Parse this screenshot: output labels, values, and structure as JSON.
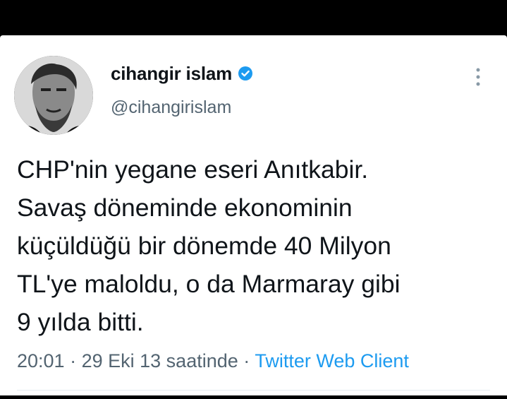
{
  "author": {
    "display_name": "cihangir islam",
    "handle": "@cihangirislam",
    "verified": true
  },
  "tweet": {
    "lines": [
      "CHP'nin yegane eseri Anıtkabir.",
      "Savaş döneminde ekonominin",
      "küçüldüğü bir dönemde 40 Milyon",
      "TL'ye maloldu, o da Marmaray gibi",
      "9 yılda bitti."
    ],
    "time": "20:01",
    "separator": "·",
    "date": "29 Eki 13 saatinde",
    "source": "Twitter Web Client"
  },
  "colors": {
    "text_primary": "#0f1419",
    "text_secondary": "#536471",
    "accent": "#1d9bf0"
  },
  "icons": {
    "verified": "verified-badge-icon",
    "more": "more-vertical-icon"
  }
}
